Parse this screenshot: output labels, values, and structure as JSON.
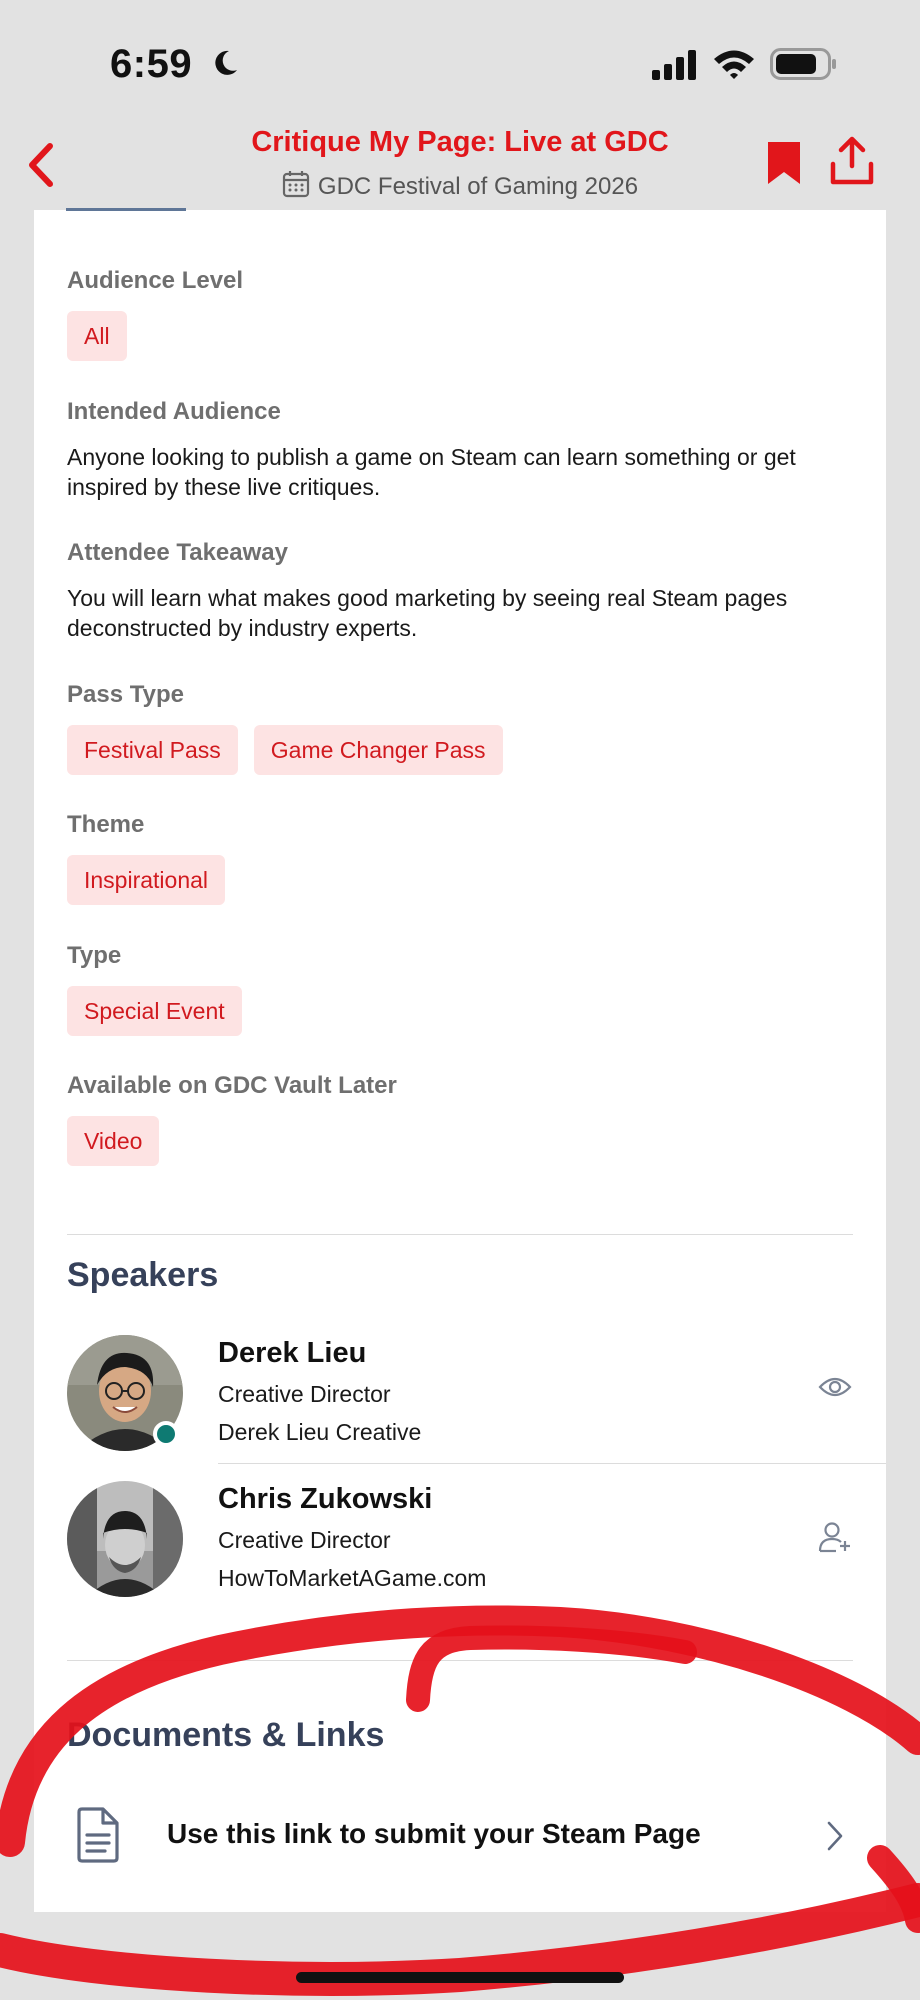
{
  "status_bar": {
    "time": "6:59"
  },
  "header": {
    "title": "Critique My Page: Live at GDC",
    "subtitle": "GDC Festival of Gaming 2026"
  },
  "details": {
    "audience_level": {
      "label": "Audience Level",
      "chips": [
        "All"
      ]
    },
    "intended_audience": {
      "label": "Intended Audience",
      "text": "Anyone looking to publish a game on Steam can learn something or get inspired by these live critiques."
    },
    "attendee_takeaway": {
      "label": "Attendee Takeaway",
      "text": "You will learn what makes good marketing by seeing real Steam pages deconstructed by industry experts."
    },
    "pass_type": {
      "label": "Pass Type",
      "chips": [
        "Festival Pass",
        "Game Changer Pass"
      ]
    },
    "theme": {
      "label": "Theme",
      "chips": [
        "Inspirational"
      ]
    },
    "type": {
      "label": "Type",
      "chips": [
        "Special Event"
      ]
    },
    "vault": {
      "label": "Available on GDC Vault Later",
      "chips": [
        "Video"
      ]
    }
  },
  "speakers": {
    "heading": "Speakers",
    "items": [
      {
        "name": "Derek Lieu",
        "role": "Creative Director",
        "org": "Derek Lieu Creative",
        "action_icon": "eye-icon"
      },
      {
        "name": "Chris Zukowski",
        "role": "Creative Director",
        "org": "HowToMarketAGame.com",
        "action_icon": "add-user-icon"
      }
    ]
  },
  "documents": {
    "heading": "Documents & Links",
    "items": [
      {
        "label": "Use this link to submit your Steam Page"
      }
    ]
  },
  "colors": {
    "accent": "#e1161b",
    "chip_bg": "#fde3e3",
    "heading": "#36415a",
    "annotation": "#e5101a"
  }
}
